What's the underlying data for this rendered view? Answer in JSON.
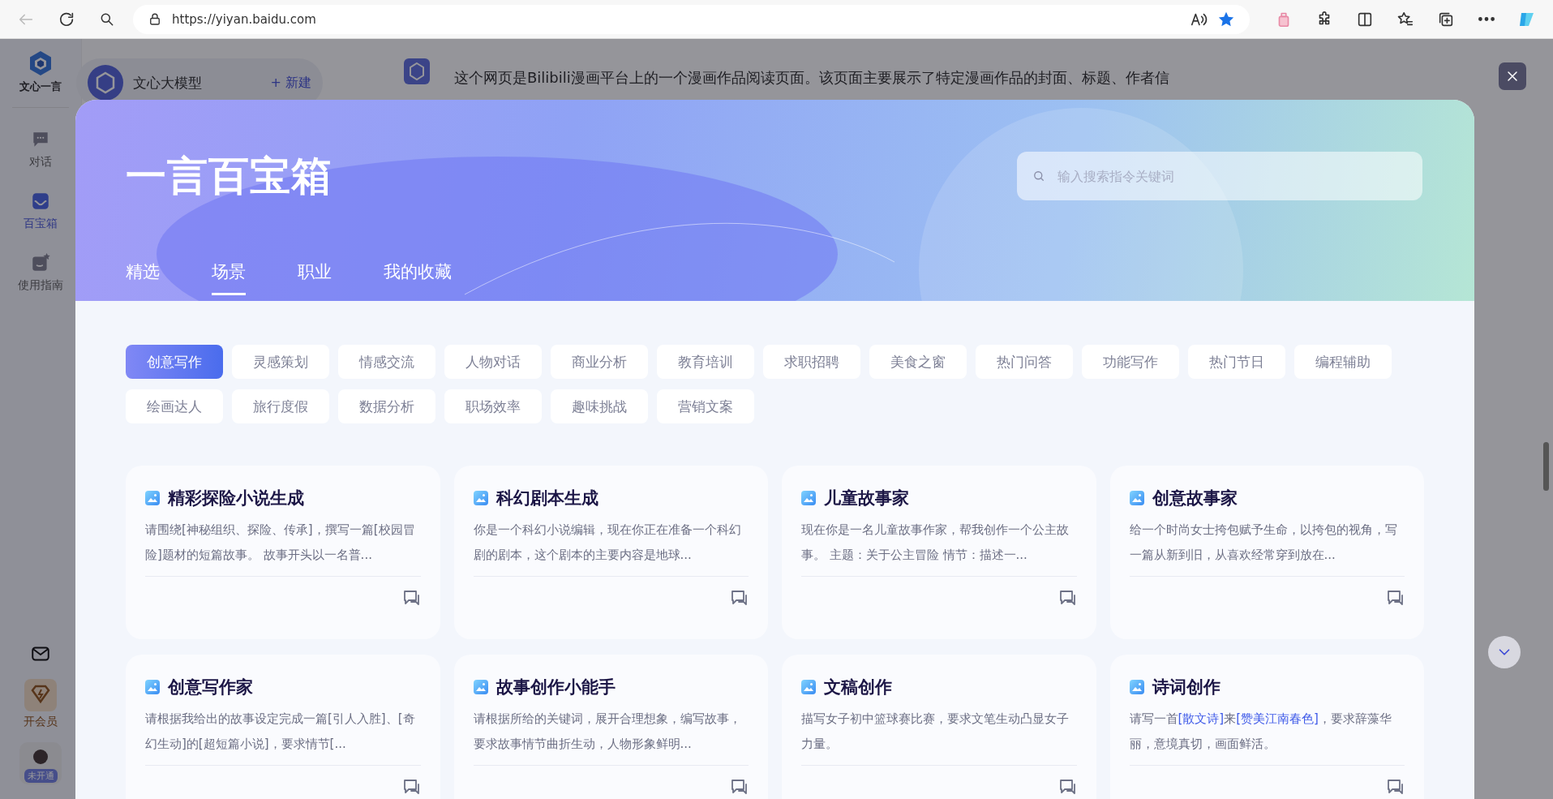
{
  "browser": {
    "url": "https://yiyan.baidu.com"
  },
  "sidebar": {
    "logo_label": "文心一言",
    "items": [
      {
        "label": "对话",
        "kind": "chat",
        "selected": false
      },
      {
        "label": "百宝箱",
        "kind": "box",
        "selected": true
      },
      {
        "label": "使用指南",
        "kind": "guide",
        "selected": false
      }
    ],
    "vip_label": "开会员",
    "avatar_badge": "未开通"
  },
  "chat": {
    "model_name": "文心大模型",
    "new_button": "+ 新建",
    "message": "这个网页是Bilibili漫画平台上的一个漫画作品阅读页面。该页面主要展示了特定漫画作品的封面、标题、作者信"
  },
  "modal": {
    "title": "一言百宝箱",
    "search": {
      "placeholder": "输入搜索指令关键词"
    },
    "tabs": [
      {
        "label": "精选",
        "selected": false
      },
      {
        "label": "场景",
        "selected": true
      },
      {
        "label": "职业",
        "selected": false
      },
      {
        "label": "我的收藏",
        "selected": false
      }
    ],
    "tags": [
      {
        "label": "创意写作",
        "selected": true
      },
      {
        "label": "灵感策划",
        "selected": false
      },
      {
        "label": "情感交流",
        "selected": false
      },
      {
        "label": "人物对话",
        "selected": false
      },
      {
        "label": "商业分析",
        "selected": false
      },
      {
        "label": "教育培训",
        "selected": false
      },
      {
        "label": "求职招聘",
        "selected": false
      },
      {
        "label": "美食之窗",
        "selected": false
      },
      {
        "label": "热门问答",
        "selected": false
      },
      {
        "label": "功能写作",
        "selected": false
      },
      {
        "label": "热门节日",
        "selected": false
      },
      {
        "label": "编程辅助",
        "selected": false
      },
      {
        "label": "绘画达人",
        "selected": false
      },
      {
        "label": "旅行度假",
        "selected": false
      },
      {
        "label": "数据分析",
        "selected": false
      },
      {
        "label": "职场效率",
        "selected": false
      },
      {
        "label": "趣味挑战",
        "selected": false
      },
      {
        "label": "营销文案",
        "selected": false
      }
    ],
    "cards": [
      {
        "title": "精彩探险小说生成",
        "description": [
          {
            "text": "请围绕[神秘组织、探险、传承]，撰写一篇[校园冒险]题材的短篇故事。 故事开头以一名普...",
            "kind": "plain"
          }
        ]
      },
      {
        "title": "科幻剧本生成",
        "description": [
          {
            "text": "你是一个科幻小说编辑，现在你正在准备一个科幻剧的剧本，这个剧本的主要内容是地球...",
            "kind": "plain"
          }
        ]
      },
      {
        "title": "儿童故事家",
        "description": [
          {
            "text": "现在你是一名儿童故事作家，帮我创作一个公主故事。 主题：关于公主冒险 情节：描述一...",
            "kind": "plain"
          }
        ]
      },
      {
        "title": "创意故事家",
        "description": [
          {
            "text": "给一个时尚女士挎包赋予生命，以挎包的视角，写一篇从新到旧，从喜欢经常穿到放在...",
            "kind": "plain"
          }
        ]
      },
      {
        "title": "创意写作家",
        "description": [
          {
            "text": "请根据我给出的故事设定完成一篇[引人入胜]、[奇幻生动]的[超短篇小说]，要求情节[...",
            "kind": "plain"
          }
        ]
      },
      {
        "title": "故事创作小能手",
        "description": [
          {
            "text": "请根据所给的关键词，展开合理想象，编写故事，要求故事情节曲折生动，人物形象鲜明...",
            "kind": "plain"
          }
        ]
      },
      {
        "title": "文稿创作",
        "description": [
          {
            "text": "描写女子初中篮球赛比赛，要求文笔生动凸显女子力量。",
            "kind": "plain"
          }
        ]
      },
      {
        "title": "诗词创作",
        "description": [
          {
            "text": "请写一首",
            "kind": "plain"
          },
          {
            "text": "[散文诗]",
            "kind": "variable"
          },
          {
            "text": "来",
            "kind": "plain"
          },
          {
            "text": "[赞美江南春色]",
            "kind": "variable"
          },
          {
            "text": "，要求辞藻华丽，意境真切，画面鲜活。",
            "kind": "plain"
          }
        ]
      }
    ]
  }
}
